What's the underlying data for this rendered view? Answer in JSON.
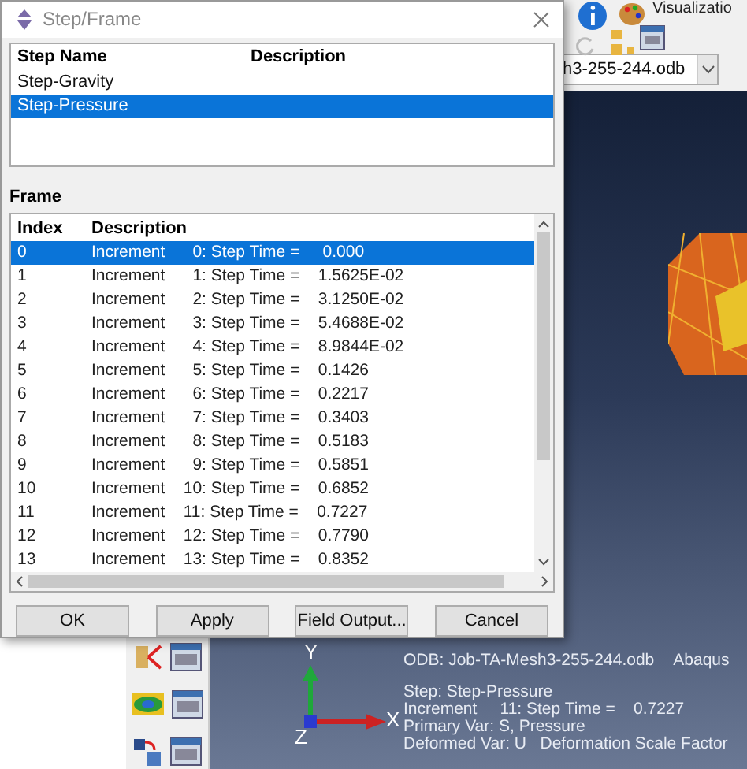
{
  "dialog": {
    "title": "Step/Frame",
    "step_table": {
      "columns": [
        "Step Name",
        "Description"
      ],
      "rows": [
        {
          "name": "Step-Gravity",
          "selected": false
        },
        {
          "name": "Step-Pressure",
          "selected": true
        }
      ]
    },
    "frame_label": "Frame",
    "frame_table": {
      "columns": [
        "Index",
        "Description"
      ],
      "rows": [
        {
          "index": "0",
          "description": "Increment      0: Step Time =     0.000",
          "selected": true
        },
        {
          "index": "1",
          "description": "Increment      1: Step Time =    1.5625E-02",
          "selected": false
        },
        {
          "index": "2",
          "description": "Increment      2: Step Time =    3.1250E-02",
          "selected": false
        },
        {
          "index": "3",
          "description": "Increment      3: Step Time =    5.4688E-02",
          "selected": false
        },
        {
          "index": "4",
          "description": "Increment      4: Step Time =    8.9844E-02",
          "selected": false
        },
        {
          "index": "5",
          "description": "Increment      5: Step Time =    0.1426",
          "selected": false
        },
        {
          "index": "6",
          "description": "Increment      6: Step Time =    0.2217",
          "selected": false
        },
        {
          "index": "7",
          "description": "Increment      7: Step Time =    0.3403",
          "selected": false
        },
        {
          "index": "8",
          "description": "Increment      8: Step Time =    0.5183",
          "selected": false
        },
        {
          "index": "9",
          "description": "Increment      9: Step Time =    0.5851",
          "selected": false
        },
        {
          "index": "10",
          "description": "Increment    10: Step Time =    0.6852",
          "selected": false
        },
        {
          "index": "11",
          "description": "Increment    11: Step Time =    0.7227",
          "selected": false
        },
        {
          "index": "12",
          "description": "Increment    12: Step Time =    0.7790",
          "selected": false
        },
        {
          "index": "13",
          "description": "Increment    13: Step Time =    0.8352",
          "selected": false
        }
      ]
    },
    "buttons": [
      "OK",
      "Apply",
      "Field Output...",
      "Cancel"
    ]
  },
  "background_app": {
    "toolbar_label": "Visualizatio",
    "odb_selector": "h3-255-244.odb",
    "viewport": {
      "odb_line": "ODB: Job-TA-Mesh3-255-244.odb",
      "product": "Abaqus",
      "step_line": "Step: Step-Pressure",
      "increment_line": "Increment     11: Step Time =    0.7227",
      "primary_var": "Primary Var: S, Pressure",
      "deformed_var": "Deformed Var: U   Deformation Scale Factor",
      "axes": {
        "y": "Y",
        "x": "X",
        "z": "Z"
      }
    }
  }
}
